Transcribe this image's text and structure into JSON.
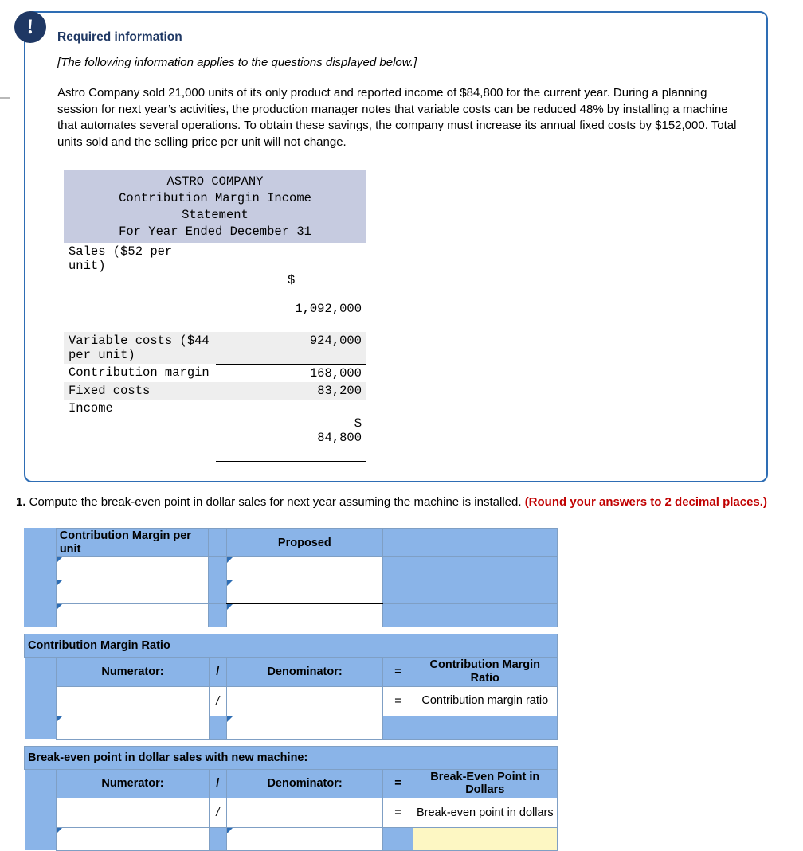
{
  "callout": {
    "badge": "!",
    "title": "Required information",
    "subtitle": "[The following information applies to the questions displayed below.]",
    "body": "Astro Company sold 21,000 units of its only product and reported income of $84,800 for the current year. During a planning session for next year’s activities, the production manager notes that variable costs can be reduced 48% by installing a machine that automates several operations. To obtain these savings, the company must increase its annual fixed costs by $152,000. Total units sold and the selling price per unit will not change."
  },
  "income_statement": {
    "title_line1": "ASTRO COMPANY",
    "title_line2": "Contribution Margin Income",
    "title_line3": "Statement",
    "title_line4": "For Year Ended December 31",
    "rows": [
      {
        "label": "Sales ($52 per unit)",
        "currency": "$",
        "amount": "1,092,000"
      },
      {
        "label": "Variable costs ($44 per unit)",
        "currency": "",
        "amount": "924,000"
      },
      {
        "label": "Contribution margin",
        "currency": "",
        "amount": "168,000"
      },
      {
        "label": "Fixed costs",
        "currency": "",
        "amount": "83,200"
      },
      {
        "label": "Income",
        "currency": "$",
        "amount": "84,800"
      }
    ]
  },
  "question": {
    "number": "1.",
    "text": " Compute the break-even point in dollar sales for next year assuming the machine is installed. ",
    "emphasis": "(Round your answers to 2 decimal places.)"
  },
  "table1": {
    "header_left": "Contribution Margin per unit",
    "header_center": "Proposed",
    "rows": 3
  },
  "table2": {
    "section_title": "Contribution Margin Ratio",
    "numerator": "Numerator:",
    "slash": "/",
    "denominator": "Denominator:",
    "equals": "=",
    "result_header": "Contribution Margin Ratio",
    "result_label": "Contribution margin ratio"
  },
  "table3": {
    "section_title": "Break-even point in dollar sales with new machine:",
    "numerator": "Numerator:",
    "slash": "/",
    "denominator": "Denominator:",
    "equals": "=",
    "result_header": "Break-Even Point in Dollars",
    "result_label": "Break-even point in dollars"
  }
}
